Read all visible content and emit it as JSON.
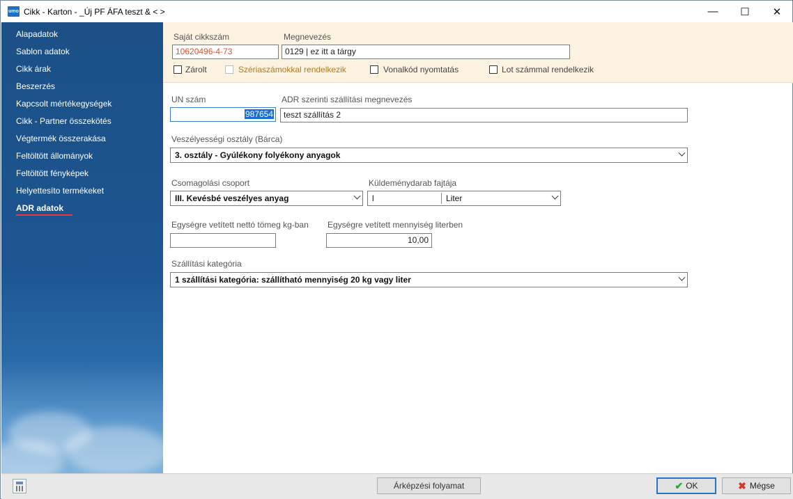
{
  "window": {
    "title": "Cikk - Karton  - _Új PF ÁFA teszt & < >",
    "app_icon_text": "umo",
    "controls": {
      "minimize": "—",
      "maximize": "☐",
      "close": "✕"
    }
  },
  "sidebar": {
    "items": [
      {
        "label": "Alapadatok"
      },
      {
        "label": "Sablon adatok"
      },
      {
        "label": "Cikk árak"
      },
      {
        "label": "Beszerzés"
      },
      {
        "label": "Kapcsolt mértékegységek"
      },
      {
        "label": "Cikk - Partner összekötés"
      },
      {
        "label": "Végtermék összerakása"
      },
      {
        "label": "Feltöltött állományok"
      },
      {
        "label": "Feltöltött fényképek"
      },
      {
        "label": "Helyettesíto termékeket"
      },
      {
        "label": "ADR adatok"
      }
    ]
  },
  "header": {
    "own_code_label": "Saját cikkszám",
    "own_code_value": "10620496-4-73",
    "name_label": "Megnevezés",
    "name_value": "0129 | ez itt a tárgy",
    "checkboxes": [
      {
        "label": "Zárolt",
        "checked": false,
        "enabled": true
      },
      {
        "label": "Szériaszámokkal rendelkezik",
        "checked": false,
        "enabled": false
      },
      {
        "label": "Vonalkód nyomtatás",
        "checked": false,
        "enabled": true
      },
      {
        "label": "Lot számmal rendelkezik",
        "checked": false,
        "enabled": true
      }
    ],
    "colors": {
      "own_code_text": "#e0502a",
      "disabled_label": "#b07a1a"
    }
  },
  "form": {
    "un_label": "UN szám",
    "un_value": "987654",
    "adr_name_label": "ADR szerinti szállítási megnevezés",
    "adr_name_value": "teszt szállítás 2",
    "hazard_class_label": "Veszélyességi osztály (Bárca)",
    "hazard_class_value": "3. osztály - Gyúlékony folyékony anyagok",
    "packing_group_label": "Csomagolási csoport",
    "packing_group_value": "III. Kevésbé veszélyes anyag",
    "package_type_label": "Küldeménydarab fajtája",
    "package_type_code": "l",
    "package_type_value": "Liter",
    "net_weight_label": "Egységre vetített nettó tömeg kg-ban",
    "net_weight_value": "",
    "quantity_label": "Egységre vetített mennyiség literben",
    "quantity_value": "10,00",
    "transport_category_label": "Szállítási kategória",
    "transport_category_value": "1 szállítási kategória:  szállítható mennyiség 20 kg vagy liter"
  },
  "footer": {
    "pricing_button": "Árképzési folyamat",
    "ok_button": "OK",
    "cancel_button": "Mégse"
  }
}
